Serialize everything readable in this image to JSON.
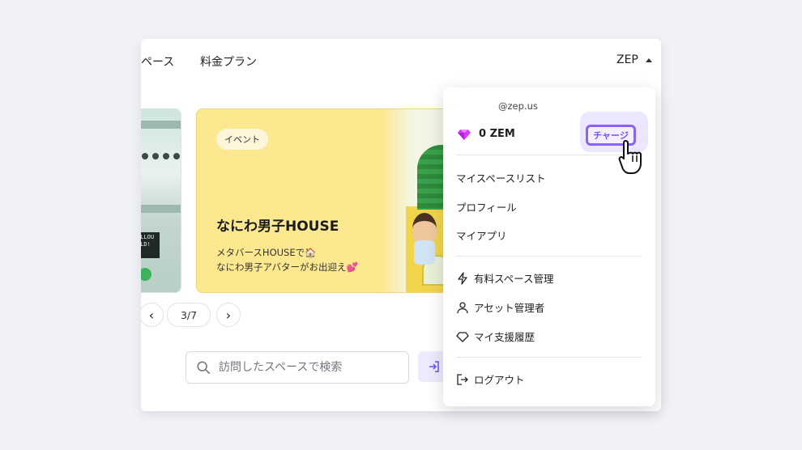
{
  "header": {
    "nav_spaces": "ペース",
    "nav_pricing": "料金プラン",
    "account_label": "ZEP"
  },
  "carousel": {
    "event_card": {
      "badge": "イベント",
      "title": "なにわ男子HOUSE",
      "desc_line1": "メタバースHOUSEで🏠",
      "desc_line2": "なにわ男子アバターがお出迎え💕"
    },
    "left_card_sign": "ALLOU\nRLD!",
    "page_counter": "3/7"
  },
  "search": {
    "placeholder": "訪問したスペースで検索"
  },
  "dropdown": {
    "email": "@zep.us",
    "zem_balance": "0 ZEM",
    "charge_label": "チャージ",
    "items": [
      {
        "label": "マイスペースリスト"
      },
      {
        "label": "プロフィール"
      },
      {
        "label": "マイアプリ"
      },
      {
        "label": "有料スペース管理",
        "icon": "lightning-icon"
      },
      {
        "label": "アセット管理者",
        "icon": "person-icon"
      },
      {
        "label": "マイ支援履歴",
        "icon": "diamond-outline-icon"
      },
      {
        "label": "ログアウト",
        "icon": "logout-icon"
      }
    ]
  },
  "colors": {
    "accent": "#8a63f2",
    "event_bg": "#fce88f",
    "page_bg": "#f1f2f6"
  }
}
